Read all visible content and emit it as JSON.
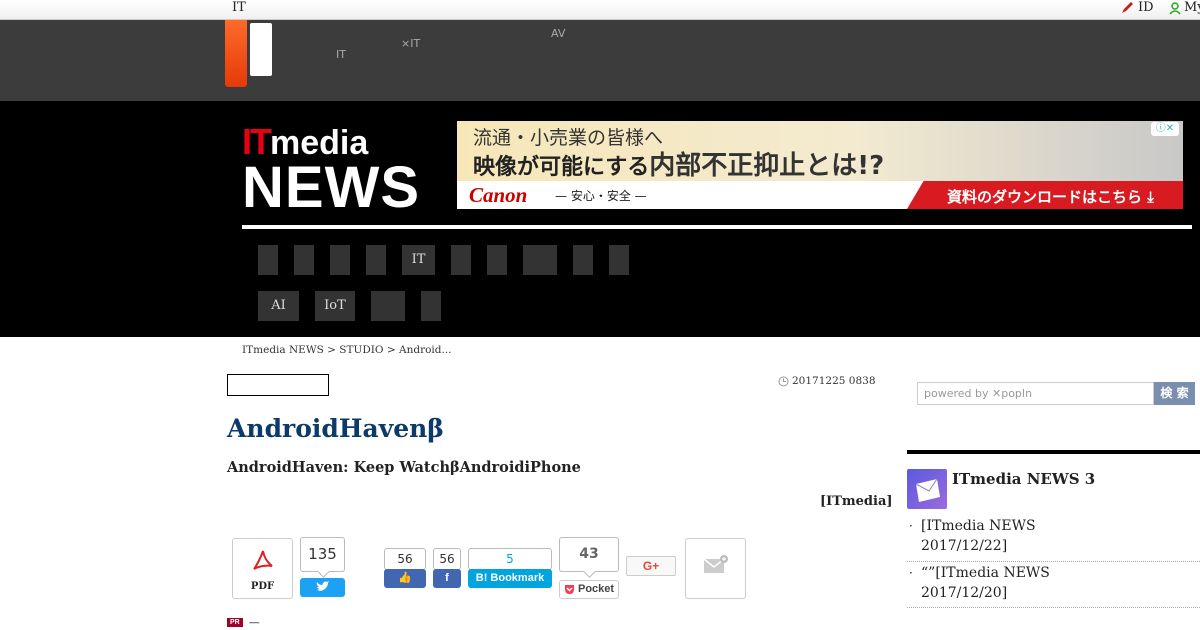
{
  "topbar": {
    "site_label": "IT",
    "id_label": "ID",
    "my_label": "My"
  },
  "header": {
    "nav": [
      {
        "label": "　　"
      },
      {
        "label": "IT"
      },
      {
        "label": "　　　"
      },
      {
        "label": "×IT"
      },
      {
        "label": "AV"
      },
      {
        "label": "　　"
      }
    ]
  },
  "brand": {
    "it": "IT",
    "media": "media",
    "news": "NEWS"
  },
  "ad": {
    "line1": "流通・小売業の皆様へ",
    "line2_pre": "映像が可能にする",
    "line2_hl": "内部不正抑止とは!?",
    "brand": "Canon",
    "tagline": "— 安心・安全 —",
    "cta": "資料のダウンロードはこちら"
  },
  "categories_row1": [
    "",
    "",
    "",
    "",
    "IT",
    "",
    "",
    "",
    "",
    ""
  ],
  "categories_row2": [
    "AI",
    "IoT",
    "",
    ""
  ],
  "breadcrumb": "ITmedia NEWS > STUDIO > Android...",
  "article": {
    "date": "20171225 0838",
    "title": "AndroidHavenβ",
    "lede": "AndroidHaven: Keep WatchβAndroidiPhone",
    "credit": "[ITmedia]"
  },
  "share": {
    "pdf_label": "PDF",
    "tweet_count": "135",
    "like_count": "56",
    "fb_count": "56",
    "hatena_count": "5",
    "hatena_label": "B! Bookmark",
    "pocket_count": "43",
    "pocket_label": "Pocket",
    "gplus_label": "G+"
  },
  "pr": {
    "badge": "PR",
    "text": "—"
  },
  "sidebar": {
    "search_placeholder": "powered by ✕popIn",
    "search_button": "検 索",
    "ranking_title": "ITmedia NEWS 3",
    "ranking_items": [
      {
        "line1": "[ITmedia NEWS",
        "line2": "2017/12/22]"
      },
      {
        "line1": "“”[ITmedia NEWS",
        "line2": "2017/12/20]"
      }
    ]
  }
}
